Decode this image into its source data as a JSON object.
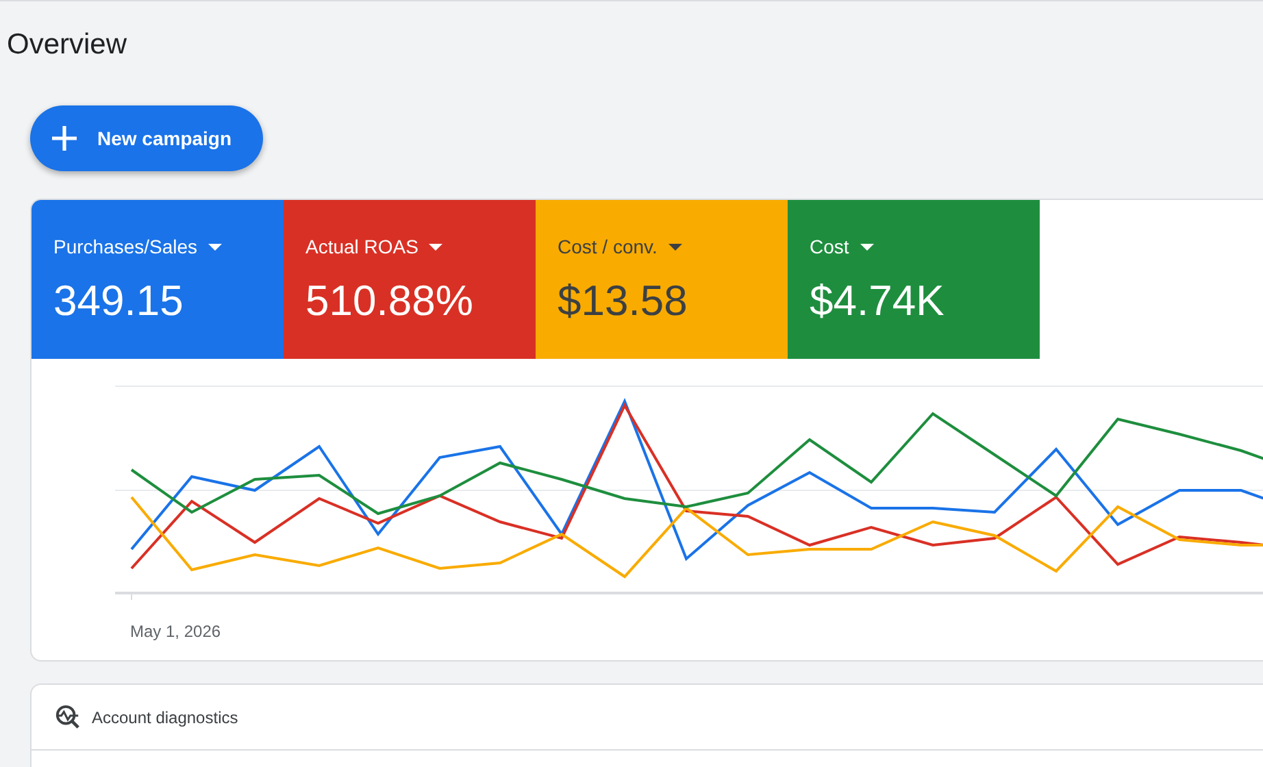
{
  "page_title": "Overview",
  "new_campaign_button": {
    "label": "New campaign"
  },
  "metrics": [
    {
      "label": "Purchases/Sales",
      "value": "349.15",
      "color": "#1a73e8"
    },
    {
      "label": "Actual ROAS",
      "value": "510.88%",
      "color": "#d93025"
    },
    {
      "label": "Cost / conv.",
      "value": "$13.58",
      "color": "#f9ab00"
    },
    {
      "label": "Cost",
      "value": "$4.74K",
      "color": "#1e8e3e"
    }
  ],
  "chart": {
    "x_label": "May 1, 2026"
  },
  "account_diagnostics": {
    "title": "Account diagnostics"
  }
}
